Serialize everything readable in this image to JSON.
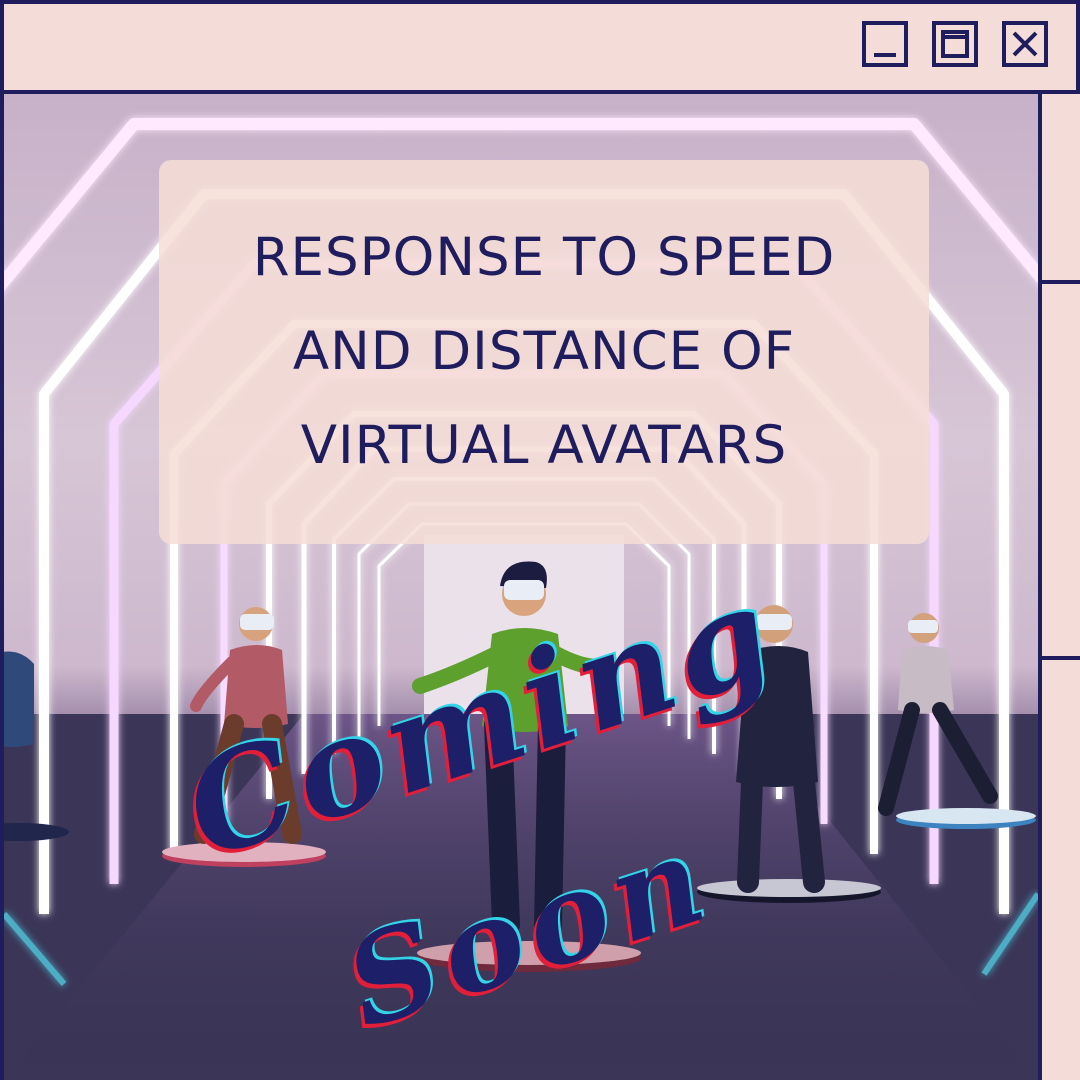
{
  "window": {
    "controls": {
      "minimize_icon": "minimize-icon",
      "maximize_icon": "maximize-icon",
      "close_icon": "close-icon"
    },
    "colors": {
      "frame": "#1f1d5e",
      "chrome": "#f4dcd8",
      "card": "#f6ddd6",
      "script_red": "#e21f3b",
      "script_cyan": "#34d3e8",
      "neon": "#ffffff"
    }
  },
  "card": {
    "title": "RESPONSE TO SPEED AND DISTANCE OF VIRTUAL AVATARS"
  },
  "overlay": {
    "line1": "Coming",
    "line2": "Soon"
  }
}
